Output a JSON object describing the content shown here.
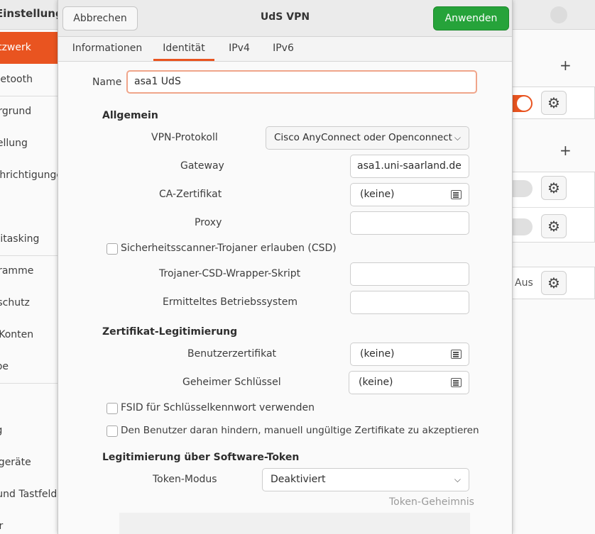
{
  "background": {
    "app_title": "Einstellungen",
    "sidebar_items": [
      {
        "label": "Netzwerk",
        "active": true
      },
      {
        "label": "Bluetooth"
      },
      {
        "label": "Hintergrund"
      },
      {
        "label": "Darstellung"
      },
      {
        "label": "Benachrichtigungen"
      },
      {
        "label": "Multitasking"
      },
      {
        "label": "Programme"
      },
      {
        "label": "Datenschutz"
      },
      {
        "label": "Online-Konten"
      },
      {
        "label": "Freigabe"
      },
      {
        "label": "Klang"
      },
      {
        "label": "Energie"
      },
      {
        "label": "Anzeigegeräte"
      },
      {
        "label": "Maus und Tastfeld"
      },
      {
        "label": "Tastatur"
      }
    ],
    "vpn_row_status": "Aus"
  },
  "dialog": {
    "title": "UdS VPN",
    "cancel_label": "Abbrechen",
    "apply_label": "Anwenden",
    "tabs": [
      "Informationen",
      "Identität",
      "IPv4",
      "IPv6"
    ],
    "active_tab": "Identität",
    "name_label": "Name",
    "name_value": "asa1 UdS",
    "general": {
      "heading": "Allgemein",
      "vpn_protocol_label": "VPN-Protokoll",
      "vpn_protocol_value": "Cisco AnyConnect oder Openconnect",
      "gateway_label": "Gateway",
      "gateway_value": "asa1.uni-saarland.de",
      "ca_cert_label": "CA-Zertifikat",
      "ca_cert_value": "(keine)",
      "proxy_label": "Proxy",
      "proxy_value": "",
      "csd_checkbox_label": "Sicherheitsscanner-Trojaner erlauben (CSD)",
      "csd_wrapper_label": "Trojaner-CSD-Wrapper-Skript",
      "csd_wrapper_value": "",
      "os_label": "Ermitteltes Betriebssystem",
      "os_value": ""
    },
    "cert_auth": {
      "heading": "Zertifikat-Legitimierung",
      "user_cert_label": "Benutzerzertifikat",
      "user_cert_value": "(keine)",
      "private_key_label": "Geheimer Schlüssel",
      "private_key_value": "(keine)",
      "fsid_checkbox_label": "FSID für Schlüsselkennwort verwenden",
      "prevent_invalid_checkbox_label": "Den Benutzer daran hindern, manuell ungültige Zertifikate zu akzeptieren"
    },
    "software_token": {
      "heading": "Legitimierung über Software-Token",
      "token_mode_label": "Token-Modus",
      "token_mode_value": "Deaktiviert",
      "token_secret_label": "Token-Geheimnis"
    }
  },
  "colors": {
    "accent": "#e95420",
    "apply_button": "#26a33a",
    "focus_border": "#f0a58a"
  }
}
